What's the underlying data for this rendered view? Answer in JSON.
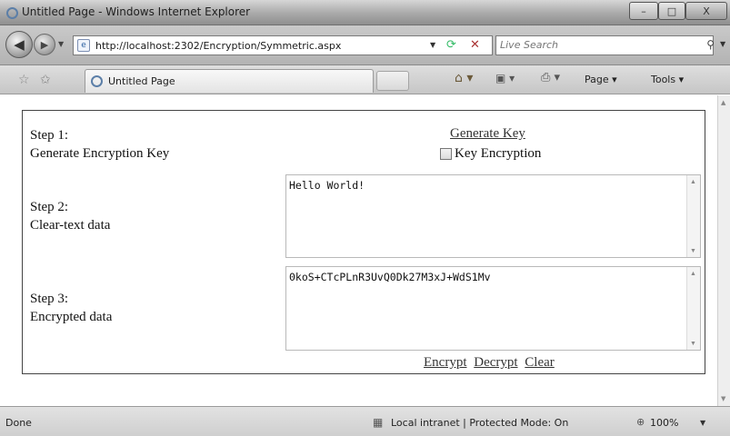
{
  "window": {
    "title": "Untitled Page - Windows Internet Explorer",
    "minimize": "–",
    "maximize": "□",
    "close": "X"
  },
  "address_bar": {
    "url": "http://localhost:2302/Encryption/Symmetric.aspx",
    "search_placeholder": "Live Search"
  },
  "command_bar": {
    "tab_title": "Untitled Page",
    "page_label": "Page ▾",
    "tools_label": "Tools ▾"
  },
  "form": {
    "step1": {
      "title": "Step 1:",
      "description": "Generate Encryption Key"
    },
    "generate_key_link": "Generate Key",
    "key_encryption_label": "Key Encryption",
    "key_encryption_checked": false,
    "step2": {
      "title": "Step 2:",
      "description": "Clear-text data"
    },
    "cleartext_value": "Hello World!",
    "step3": {
      "title": "Step 3:",
      "description": "Encrypted data"
    },
    "encrypted_value": "0koS+CTcPLnR3UvQ0Dk27M3xJ+WdS1Mv",
    "actions": {
      "encrypt": "Encrypt",
      "decrypt": "Decrypt",
      "clear": "Clear"
    }
  },
  "status_bar": {
    "status": "Done",
    "zone": "Local intranet | Protected Mode: On",
    "zoom": "100%"
  },
  "icons": {
    "ie": "ie-logo-icon",
    "back": "back-arrow-icon",
    "forward": "forward-arrow-icon",
    "refresh": "refresh-icon",
    "stop": "stop-icon",
    "search": "search-icon",
    "favorites": "favorites-star-icon",
    "add_favorite": "add-favorite-icon",
    "home": "home-icon",
    "feeds": "feeds-icon",
    "print": "print-icon",
    "zone": "intranet-zone-icon",
    "zoom": "zoom-icon"
  }
}
